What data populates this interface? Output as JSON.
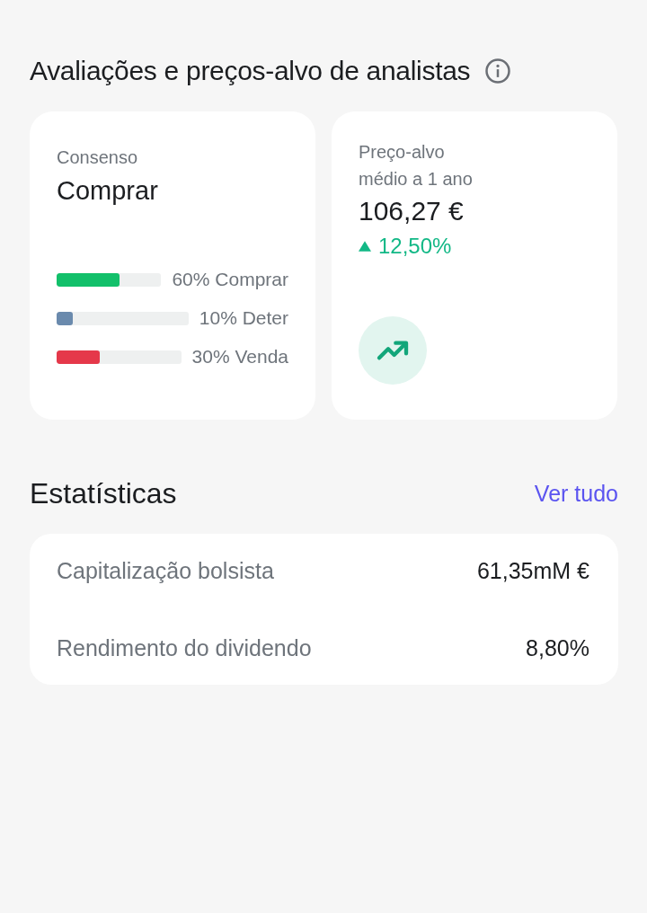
{
  "analyst_section": {
    "title": "Avaliações e preços-alvo de analistas",
    "consensus_card": {
      "label": "Consenso",
      "value": "Comprar",
      "ratings": [
        {
          "label": "60% Comprar",
          "level": 0.6,
          "color": "#12c06a"
        },
        {
          "label": "10% Deter",
          "level": 0.12,
          "color": "#6a8aad"
        },
        {
          "label": "30% Venda",
          "level": 0.35,
          "color": "#e5384a"
        }
      ]
    },
    "target_card": {
      "label": "Preço-alvo médio a 1 ano",
      "value": "106,27 €",
      "change": "12,50%",
      "rising": true
    }
  },
  "statistics": {
    "title": "Estatísticas",
    "link": "Ver tudo",
    "rows": [
      {
        "label": "Capitalização bolsista",
        "value": "61,35mM €"
      },
      {
        "label": "Rendimento do dividendo",
        "value": "8,80%"
      }
    ]
  }
}
